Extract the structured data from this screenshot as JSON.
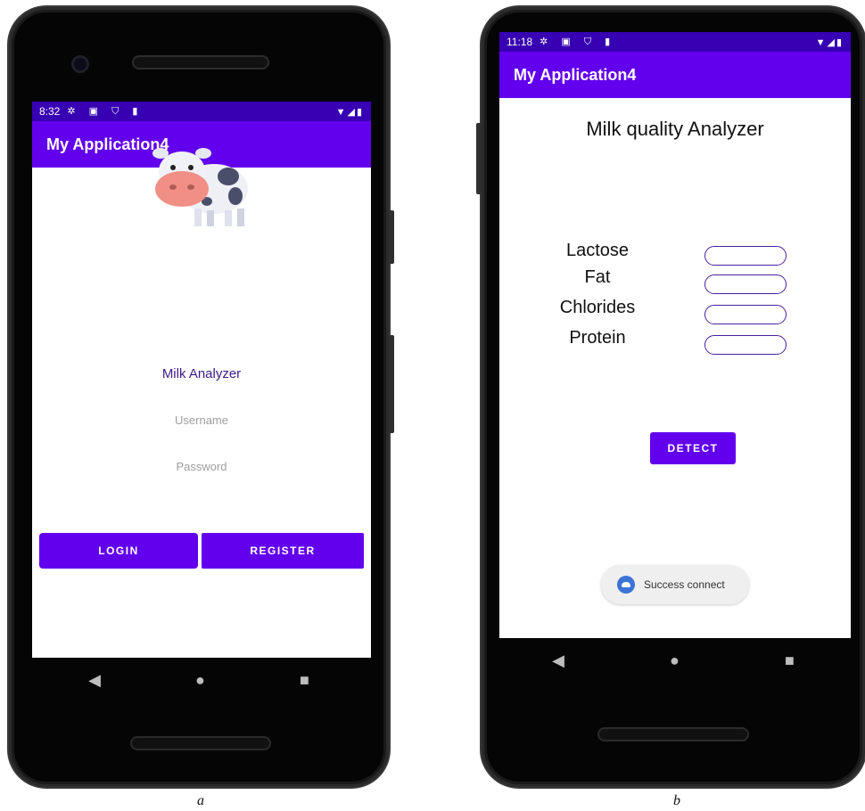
{
  "left_phone": {
    "status_time": "8:32",
    "status_icons": "✲ ▣ ⛉ ▮",
    "status_right": "▼◢▮",
    "app_title": "My Application4",
    "heading": "Milk Analyzer",
    "username_placeholder": "Username",
    "password_placeholder": "Password",
    "login_label": "LOGIN",
    "register_label": "REGISTER",
    "nav": {
      "back": "◀",
      "home": "●",
      "recents": "■"
    }
  },
  "right_phone": {
    "status_time": "11:18",
    "status_icons": "✲ ▣ ⛉ ▮",
    "status_right": "▼◢▮",
    "app_title": "My Application4",
    "heading": "Milk quality Analyzer",
    "fields": [
      {
        "label": "Lactose"
      },
      {
        "label": "Fat"
      },
      {
        "label": "Chlorides"
      },
      {
        "label": "Protein"
      }
    ],
    "detect_label": "DETECT",
    "toast_text": "Success connect",
    "nav": {
      "back": "◀",
      "home": "●",
      "recents": "■"
    }
  },
  "captions": {
    "left": "a",
    "right": "b"
  },
  "colors": {
    "primary": "#6200ee",
    "status": "#3700b3",
    "toast_icon": "#3d73d6"
  },
  "icons": [
    "cow-icon",
    "settings-icon",
    "notification-icon",
    "shield-icon",
    "sd-card-icon",
    "wifi-icon",
    "signal-icon",
    "battery-icon",
    "back-icon",
    "home-icon",
    "recents-icon",
    "android-icon"
  ]
}
